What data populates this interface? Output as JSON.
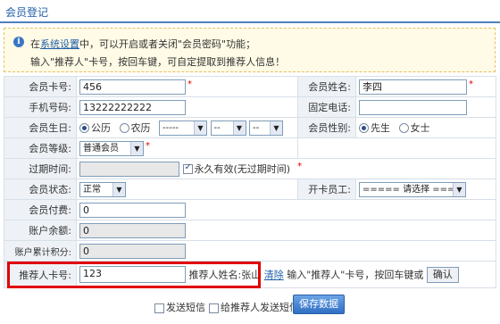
{
  "page": {
    "title": "会员登记"
  },
  "notice": {
    "line1_prefix": "在",
    "line1_link": "系统设置",
    "line1_suffix": "中，可以开启或者关闭\"会员密码\"功能；",
    "line2": "输入\"推荐人\"卡号，按回车键，可自定提取到推荐人信息！"
  },
  "form": {
    "card_no": {
      "label": "会员卡号:",
      "value": "456"
    },
    "member_name": {
      "label": "会员姓名:",
      "value": "李四"
    },
    "phone": {
      "label": "手机号码:",
      "value": "13222222222"
    },
    "landline": {
      "label": "固定电话:",
      "value": ""
    },
    "birthday": {
      "label": "会员生日:",
      "solar": "公历",
      "lunar": "农历",
      "year": "-----",
      "month": "--",
      "day": "--"
    },
    "gender": {
      "label": "会员性别:",
      "male": "先生",
      "female": "女士"
    },
    "level": {
      "label": "会员等级:",
      "value": "普通会员"
    },
    "expiry": {
      "label": "过期时间:",
      "value": "",
      "forever": "永久有效(无过期时间)"
    },
    "status": {
      "label": "会员状态:",
      "value": "正常"
    },
    "staff": {
      "label": "开卡员工:",
      "value": "===== 请选择 ====="
    },
    "fee": {
      "label": "会员付费:",
      "value": "0"
    },
    "balance": {
      "label": "账户余额:",
      "value": "0"
    },
    "points": {
      "label": "账户累计积分:",
      "value": "0"
    },
    "referrer": {
      "label": "推荐人卡号:",
      "value": "123",
      "name_label": "推荐人姓名:",
      "name_value": "张山",
      "clear": "清除",
      "hint": "输入\"推荐人\"卡号，按回车键或",
      "confirm": "确认"
    }
  },
  "bottom": {
    "send_sms": "发送短信",
    "send_referrer_sms": "给推荐人发送短信",
    "save": "保存数据"
  }
}
